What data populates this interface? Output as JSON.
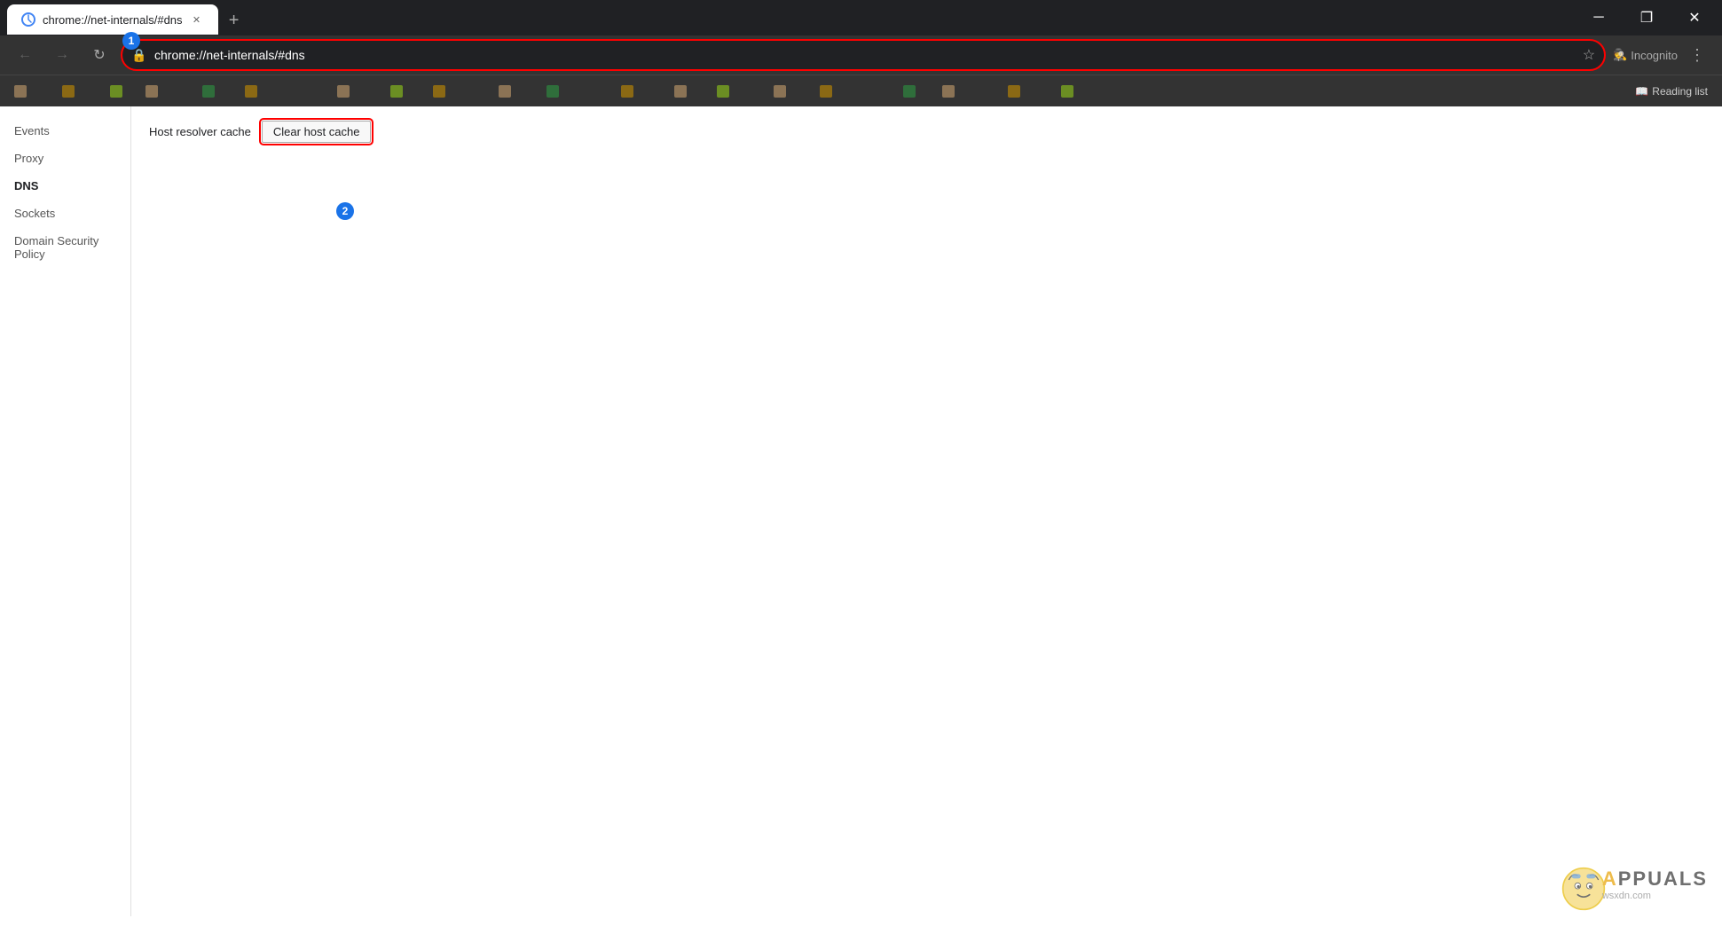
{
  "browser": {
    "title_bar": {
      "tab_title": "chrome://net-internals/#dns",
      "tab_favicon": "chrome-icon",
      "new_tab_label": "+",
      "minimize_label": "─",
      "restore_label": "❐",
      "close_label": "✕"
    },
    "address_bar": {
      "back_icon": "←",
      "forward_icon": "→",
      "refresh_icon": "↻",
      "url": "chrome://net-internals/#dns",
      "url_display": "chrome://net-internals/#dns",
      "star_icon": "☆",
      "incognito_label": "Incognito",
      "menu_icon": "⋮"
    },
    "bookmarks": [
      {
        "label": "",
        "color": "#8B7355"
      },
      {
        "label": "",
        "color": "#8B6914"
      },
      {
        "label": "",
        "color": "#6B8E23"
      },
      {
        "label": "",
        "color": "#8B7355"
      },
      {
        "label": "",
        "color": "#8B6914"
      },
      {
        "label": "",
        "color": "#6B8E23"
      },
      {
        "label": "",
        "color": "#8B7355"
      },
      {
        "label": "",
        "color": "#8B6914"
      },
      {
        "label": "",
        "color": "#6B8E23"
      },
      {
        "label": "",
        "color": "#8B7355"
      },
      {
        "label": "",
        "color": "#8B6914"
      },
      {
        "label": "",
        "color": "#6B8E23"
      },
      {
        "label": "",
        "color": "#8B7355"
      },
      {
        "label": "",
        "color": "#8B6914"
      },
      {
        "label": "",
        "color": "#6B8E23"
      },
      {
        "label": "",
        "color": "#8B7355"
      },
      {
        "label": "",
        "color": "#8B6914"
      },
      {
        "label": "",
        "color": "#6B8E23"
      },
      {
        "label": "",
        "color": "#8B7355"
      },
      {
        "label": "",
        "color": "#8B6914"
      },
      {
        "label": "",
        "color": "#6B8E23"
      },
      {
        "label": "",
        "color": "#8B7355"
      },
      {
        "label": "",
        "color": "#8B6914"
      },
      {
        "label": "",
        "color": "#6B8E23"
      }
    ],
    "reading_list_label": "Reading list"
  },
  "sidebar": {
    "items": [
      {
        "label": "Events",
        "active": false
      },
      {
        "label": "Proxy",
        "active": false
      },
      {
        "label": "DNS",
        "active": true
      },
      {
        "label": "Sockets",
        "active": false
      },
      {
        "label": "Domain Security Policy",
        "active": false
      }
    ]
  },
  "dns_page": {
    "host_resolver_label": "Host resolver cache",
    "clear_button_label": "Clear host cache"
  },
  "annotations": {
    "badge1_number": "1",
    "badge2_number": "2"
  },
  "watermark": {
    "text_part1": "A",
    "text_brand": "PPUALS",
    "site": "wsxdn.com"
  }
}
